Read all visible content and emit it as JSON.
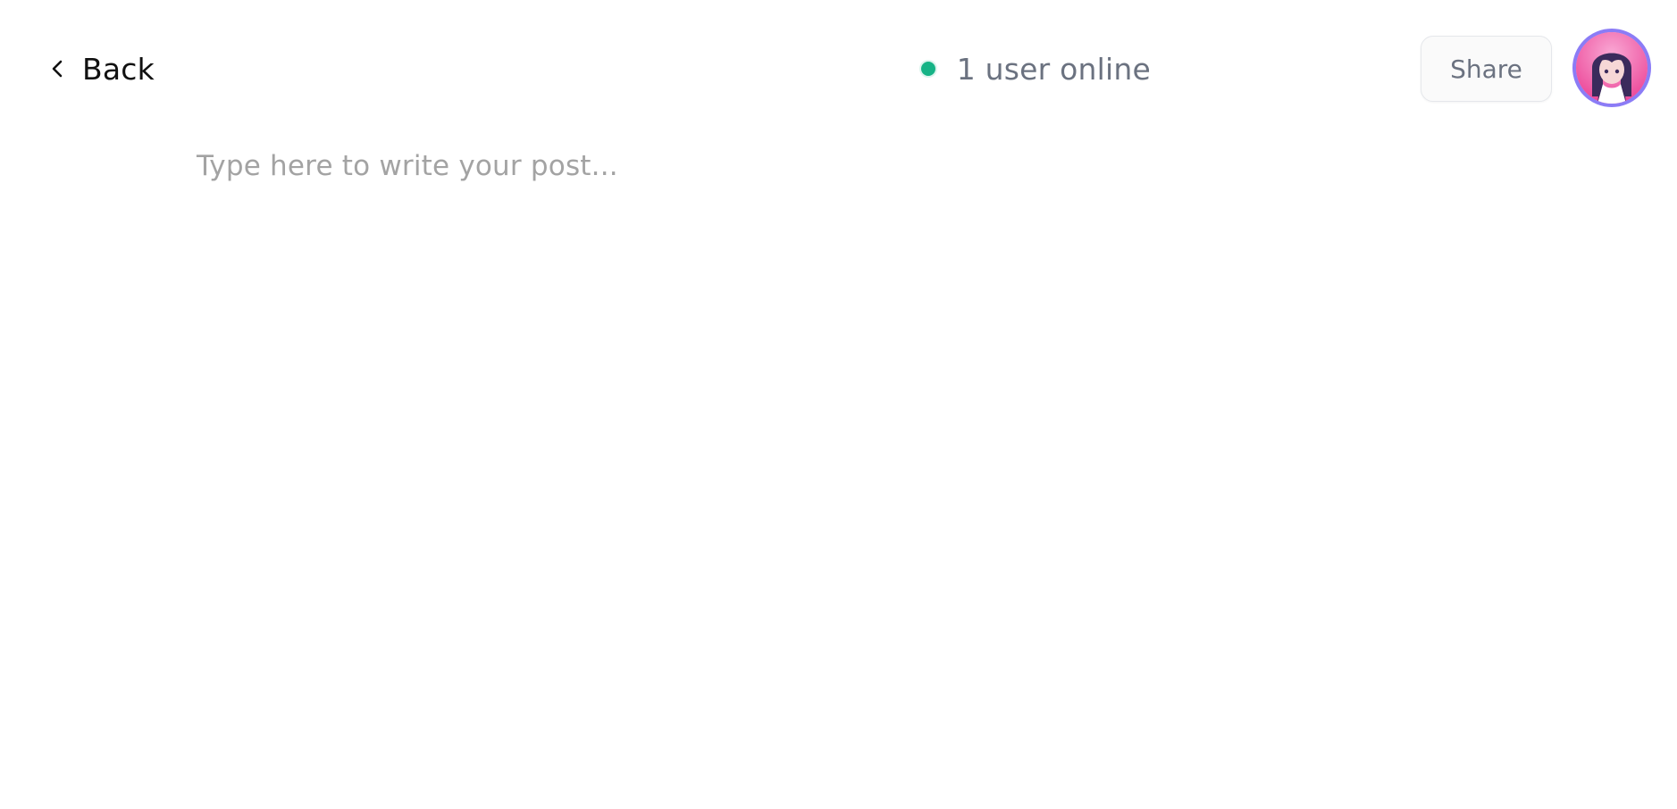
{
  "header": {
    "back_label": "Back",
    "online_status": "1 user online",
    "share_label": "Share"
  },
  "editor": {
    "placeholder": "Type here to write your post..."
  },
  "colors": {
    "online_dot": "#16B386",
    "avatar_ring": "#8B7CF6",
    "placeholder_text": "#A3A3A3",
    "muted_text": "#6B7280"
  },
  "icons": {
    "back": "chevron-left-icon",
    "online": "status-dot-icon"
  }
}
